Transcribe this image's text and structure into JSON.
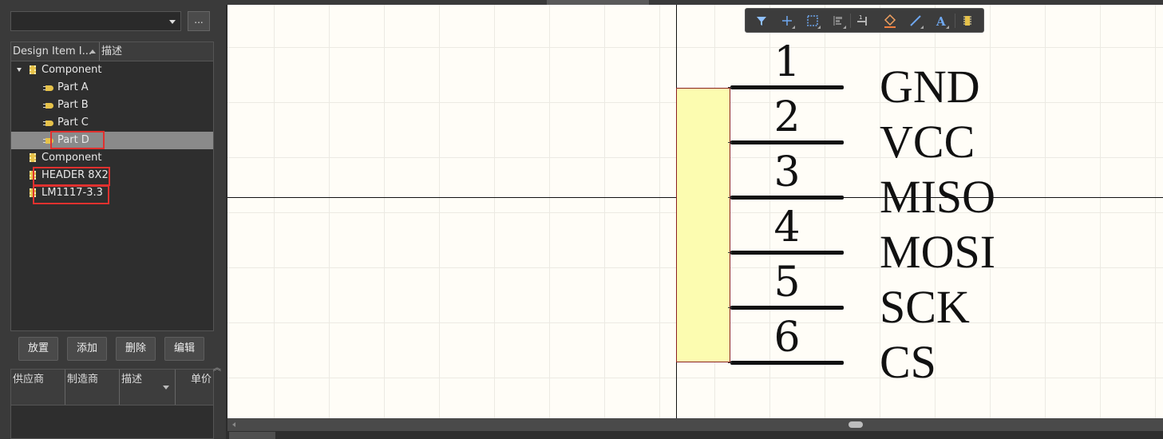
{
  "library_panel": {
    "browse_label": "...",
    "tree_columns": {
      "design_item": "Design Item I...",
      "description": "描述"
    },
    "tree_items": [
      {
        "label": "Component",
        "type": "component",
        "expanded": true
      },
      {
        "label": "Part A",
        "type": "part"
      },
      {
        "label": "Part B",
        "type": "part"
      },
      {
        "label": "Part C",
        "type": "part"
      },
      {
        "label": "Part D",
        "type": "part",
        "selected": true
      },
      {
        "label": "Component",
        "type": "component"
      },
      {
        "label": "HEADER 8X2",
        "type": "component"
      },
      {
        "label": "LM1117-3.3",
        "type": "component"
      }
    ],
    "buttons": {
      "place": "放置",
      "add": "添加",
      "delete": "删除",
      "edit": "编辑"
    },
    "supplier_columns": [
      "供应商",
      "制造商",
      "描述",
      "单价"
    ]
  },
  "toolbar": {
    "icons": [
      "filter-icon",
      "add-cross-icon",
      "select-rect-icon",
      "align-icon",
      "pin-icon",
      "fill-icon",
      "line-icon",
      "text-icon",
      "part-icon"
    ]
  },
  "schematic": {
    "pins": [
      {
        "number": "1",
        "name": "GND"
      },
      {
        "number": "2",
        "name": "VCC"
      },
      {
        "number": "3",
        "name": "MISO"
      },
      {
        "number": "4",
        "name": "MOSI"
      },
      {
        "number": "5",
        "name": "SCK"
      },
      {
        "number": "6",
        "name": "CS"
      }
    ]
  },
  "colors": {
    "canvas_bg": "#fffdf7",
    "component_fill": "#fcfcb0",
    "highlight_box": "#e0312f",
    "selected_row": "#8a8a8a"
  }
}
